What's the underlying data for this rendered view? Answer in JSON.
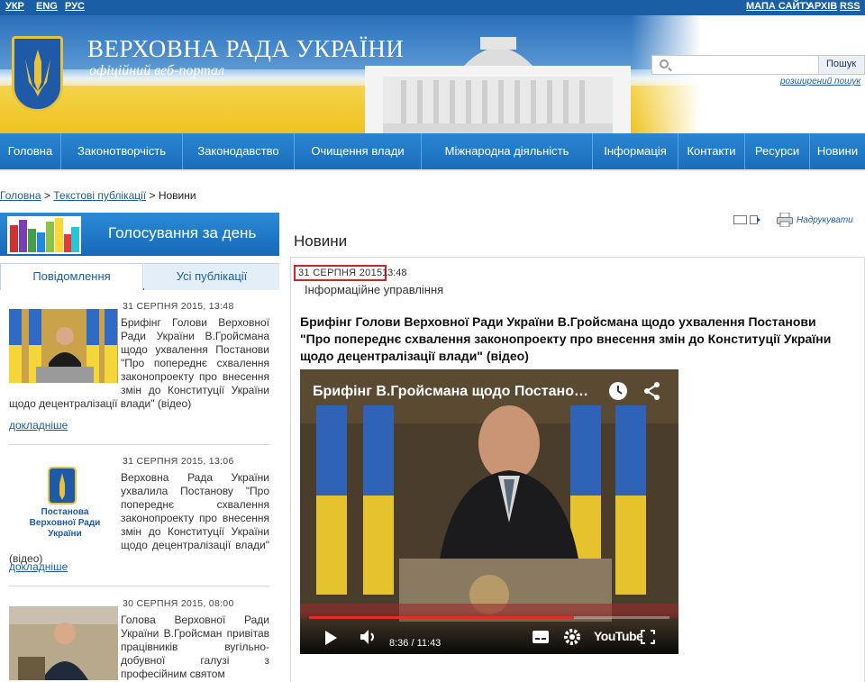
{
  "top_links": {
    "ukr": "УКР",
    "eng": "ENG",
    "rus": "РУС",
    "sitemap": "МАПА САЙТУ",
    "archive": "АРХІВ",
    "rss": "RSS"
  },
  "header": {
    "title": "ВЕРХОВНА РАДА УКРАЇНИ",
    "subtitle": "офіційний веб-портал"
  },
  "search": {
    "placeholder": "",
    "button": "Пошук",
    "advanced": "розширений пошук"
  },
  "nav": [
    "Головна",
    "Законотворчість",
    "Законодавство",
    "Очищення влади",
    "Міжнародна діяльність",
    "Інформація",
    "Контакти",
    "Ресурси",
    "Новини"
  ],
  "breadcrumb": {
    "home": "Головна",
    "section": "Текстові публікації",
    "current": "Новини",
    "sep": ">"
  },
  "sidebar": {
    "vote_title": "Голосування за день",
    "tabs": [
      "Повідомлення",
      "Усі публікації"
    ],
    "items": [
      {
        "date": "31 СЕРПНЯ 2015, 13:48",
        "text": "Брифінг Голови Верховної Ради України В.Гройсмана щодо ухвалення Постанови \"Про попереднє схвалення законопроекту про внесення змін до Конституції України щодо децентралізації влади\" (відео)",
        "more": "докладніше"
      },
      {
        "date": "31 СЕРПНЯ 2015, 13:06",
        "text": "Верховна Рада України ухвалила Постанову \"Про попереднє схвалення законопроекту про внесення змін до Конституції України щодо децентралізації влади\" (відео)",
        "more": "докладніше",
        "thumb_label": "Постанова Верховної Ради України"
      },
      {
        "date": "30 СЕРПНЯ 2015, 08:00",
        "text": "Голова Верховної Ради України В.Гройсман привітав працівників вугільно-добувної галузі з професійним святом"
      }
    ]
  },
  "tools": {
    "print": "Надрукувати"
  },
  "article": {
    "section_title": "Новини",
    "date": "31 СЕРПНЯ 2015",
    "time": "13:48",
    "author": "Інформаційне управління",
    "title": "Брифінг Голови Верховної Ради України В.Гройсмана щодо ухвалення Постанови \"Про попереднє схвалення законопроекту про внесення змін до Конституції України щодо децентралізації влади\" (відео)"
  },
  "video": {
    "title": "Брифінг В.Гройсмана щодо Постано…",
    "elapsed": "8:36",
    "duration": "11:43",
    "progress": 0.734,
    "badge": "YouTube"
  },
  "colors": {
    "nav_blue": "#1a6dbb",
    "top_bar": "#1a5fa6",
    "date_border": "#d12525",
    "yt_red": "#e52d27"
  }
}
